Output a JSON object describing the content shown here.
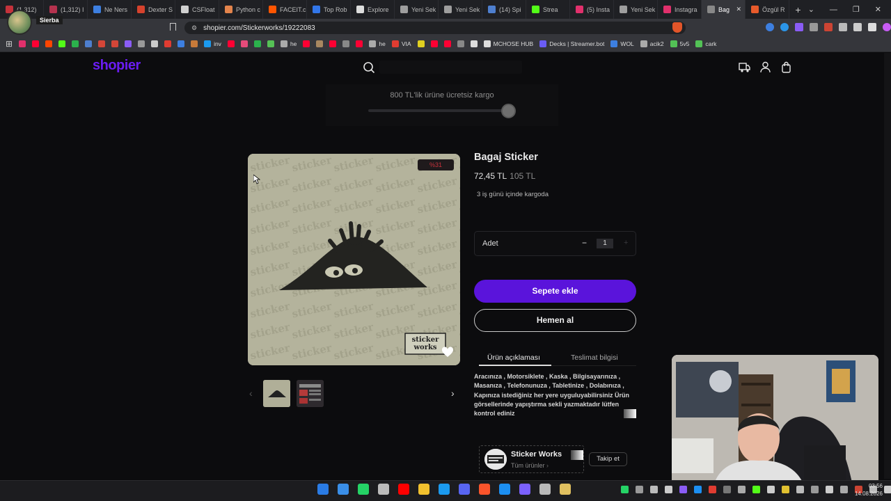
{
  "browser": {
    "tabs": [
      {
        "label": "(1,312)",
        "color": "#c4323b"
      },
      {
        "label": "(1,312) I",
        "color": "#b5324e"
      },
      {
        "label": "Ne Ners",
        "color": "#3d7fe0"
      },
      {
        "label": "Dexter S",
        "color": "#d5422d"
      },
      {
        "label": "CSFloat",
        "color": "#d0d0d0"
      },
      {
        "label": "Python c",
        "color": "#e3844c"
      },
      {
        "label": "FACEIT.c",
        "color": "#ff5500"
      },
      {
        "label": "Top Rob",
        "color": "#3276e8"
      },
      {
        "label": "Explore",
        "color": "#dddddd"
      },
      {
        "label": "Yeni Sek",
        "color": "#9e9e9e"
      },
      {
        "label": "Yeni Sek",
        "color": "#9e9e9e"
      },
      {
        "label": "(14) Spi",
        "color": "#4e7fcf"
      },
      {
        "label": "Strea",
        "color": "#53fc18"
      },
      {
        "label": "(5) Insta",
        "color": "#e1306c"
      },
      {
        "label": "Yeni Sek",
        "color": "#9e9e9e"
      },
      {
        "label": "Instagra",
        "color": "#e1306c"
      },
      {
        "label": "Bag",
        "color": "#888888",
        "active": true
      },
      {
        "label": "Özgül R",
        "color": "#e75a2b"
      }
    ],
    "url": "shopier.com/Stickerworks/19222083",
    "profile_name": "Sierba",
    "bookmarks": [
      {
        "label": "",
        "color": "#e1306c"
      },
      {
        "label": "",
        "color": "#ff0033"
      },
      {
        "label": "",
        "color": "#ff4500"
      },
      {
        "label": "",
        "color": "#53fc18"
      },
      {
        "label": "",
        "color": "#2bb24c"
      },
      {
        "label": "",
        "color": "#4e7fcf"
      },
      {
        "label": "",
        "color": "#d44638"
      },
      {
        "label": "",
        "color": "#d44638"
      },
      {
        "label": "",
        "color": "#8a5cf5"
      },
      {
        "label": "",
        "color": "#999999"
      },
      {
        "label": "",
        "color": "#cccccc"
      },
      {
        "label": "",
        "color": "#e03c31"
      },
      {
        "label": "",
        "color": "#3d7fe0"
      },
      {
        "label": "",
        "color": "#c77a3a"
      },
      {
        "label": "inv",
        "color": "#1b9aef"
      },
      {
        "label": "",
        "color": "#ff0033"
      },
      {
        "label": "",
        "color": "#e54b7a"
      },
      {
        "label": "",
        "color": "#2bb24c"
      },
      {
        "label": "",
        "color": "#56c256"
      },
      {
        "label": "he",
        "color": "#aaaaaa"
      },
      {
        "label": "",
        "color": "#ff0033"
      },
      {
        "label": "",
        "color": "#a88760"
      },
      {
        "label": "",
        "color": "#ff0033"
      },
      {
        "label": "",
        "color": "#888888"
      },
      {
        "label": "",
        "color": "#ff0033"
      },
      {
        "label": "he",
        "color": "#aaaaaa"
      },
      {
        "label": "VIA",
        "color": "#e03c31"
      },
      {
        "label": "",
        "color": "#e0d020"
      },
      {
        "label": "",
        "color": "#ff0033"
      },
      {
        "label": "",
        "color": "#ff0033"
      },
      {
        "label": "",
        "color": "#888888"
      },
      {
        "label": "",
        "color": "#dddddd"
      },
      {
        "label": "MCHOSE HUB",
        "color": "#dddddd"
      },
      {
        "label": "Decks | Streamer.bot",
        "color": "#6a5cf5"
      },
      {
        "label": "WOL",
        "color": "#3d7fe0"
      },
      {
        "label": "acik2",
        "color": "#aaaaaa"
      },
      {
        "label": "5v5",
        "color": "#53c256"
      },
      {
        "label": "cark",
        "color": "#53c256"
      }
    ]
  },
  "header": {
    "logo": "shopier",
    "shipping_banner": "800 TL'lik ürüne ücretsiz kargo",
    "shipping_progress": 1.0
  },
  "product": {
    "title": "Bagaj Sticker",
    "price": "72,45 TL",
    "old_price": "105 TL",
    "discount_badge": "%31",
    "delivery": "3 iş günü içinde kargoda",
    "quantity_label": "Adet",
    "quantity_minus": "−",
    "quantity": "1",
    "quantity_plus": "+",
    "add_to_cart": "Sepete ekle",
    "buy_now": "Hemen al",
    "tabs": [
      "Ürün açıklaması",
      "Teslimat bilgisi"
    ],
    "description": "Aracınıza , Motorsiklete , Kaska , Bilgisayarınıza , Masanıza , Telefonunuza , Tabletinize , Dolabınıza , Kapınıza istediğiniz her yere uyguluyabilirsiniz Ürün görsellerinde yapıştırma sekli yazmaktadır lütfen kontrol ediniz",
    "image_watermark": "sticker works",
    "thumb_prev": "‹",
    "thumb_next": "›"
  },
  "store": {
    "name": "Sticker Works",
    "subtitle": "Tüm ürünler",
    "follow": "Takip et"
  },
  "taskbar": {
    "apps": [
      "#2a7be4",
      "#3a8ee8",
      "#25d366",
      "#bbbbbb",
      "#ff0000",
      "#f2c12e",
      "#1b9aef",
      "#5865f2",
      "#fb542b",
      "#1c8ff2",
      "#7b61ff",
      "#b9b9b9",
      "#e0c060"
    ],
    "time": "03:56",
    "date": "14.08.2026"
  }
}
